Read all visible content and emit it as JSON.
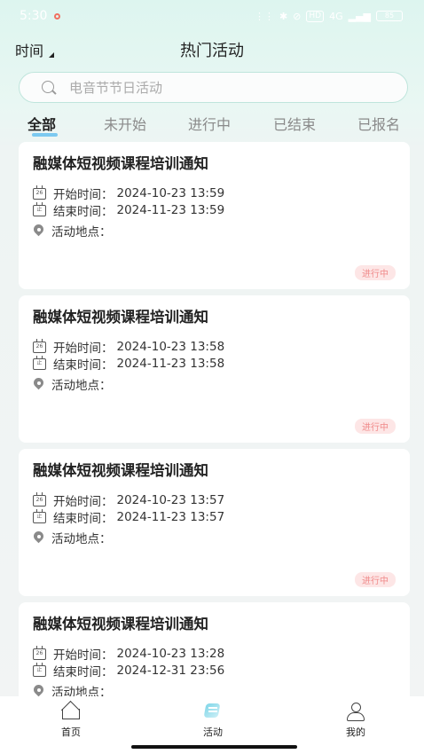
{
  "status_bar": {
    "time": "5:30",
    "signal_text": "4G",
    "hd_label": "HD",
    "battery": "85"
  },
  "nav": {
    "time_filter": "时间",
    "title": "热门活动"
  },
  "search": {
    "placeholder": "电音节节日活动"
  },
  "tabs": [
    {
      "label": "全部",
      "active": true
    },
    {
      "label": "未开始"
    },
    {
      "label": "进行中"
    },
    {
      "label": "已结束"
    },
    {
      "label": "已报名"
    }
  ],
  "labels": {
    "start": "开始时间：",
    "end": "结束时间：",
    "location": "活动地点：",
    "cal_start": "26",
    "cal_end": "止"
  },
  "events": [
    {
      "title": "融媒体短视频课程培训通知",
      "start": "2024-10-23 13:59",
      "end": "2024-11-23 13:59",
      "location": "",
      "status": "进行中"
    },
    {
      "title": "融媒体短视频课程培训通知",
      "start": "2024-10-23 13:58",
      "end": "2024-11-23 13:58",
      "location": "",
      "status": "进行中"
    },
    {
      "title": "融媒体短视频课程培训通知",
      "start": "2024-10-23 13:57",
      "end": "2024-11-23 13:57",
      "location": "",
      "status": "进行中"
    },
    {
      "title": "融媒体短视频课程培训通知",
      "start": "2024-10-23 13:28",
      "end": "2024-12-31 23:56",
      "location": ""
    }
  ],
  "bottom_nav": {
    "home": "首页",
    "activity": "活动",
    "profile": "我的"
  },
  "colors": {
    "accent": "#7cc9f0",
    "badge_text": "#f08a8a",
    "badge_bg": "#fde6e6"
  }
}
